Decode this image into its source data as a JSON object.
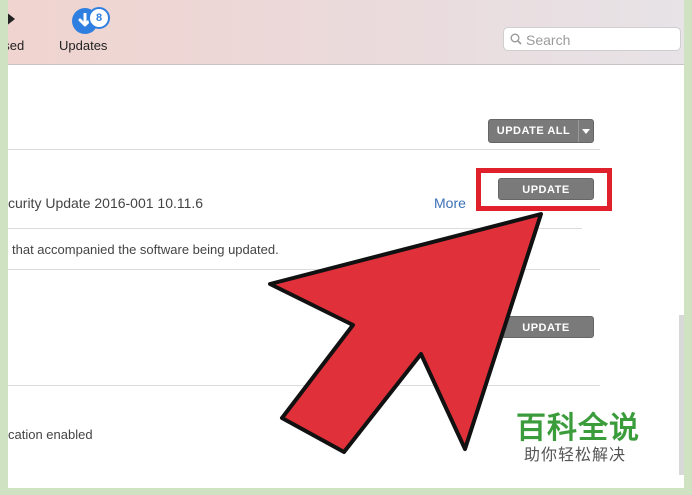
{
  "toolbar": {
    "purchased_label": "ased",
    "updates_label": "Updates",
    "updates_badge": "8"
  },
  "search": {
    "placeholder": "Search"
  },
  "main": {
    "update_all_label": "UPDATE ALL",
    "item1": {
      "title": "curity Update 2016-001 10.11.6",
      "more_label": "More",
      "button_label": "UPDATE",
      "note": "that accompanied the software being updated."
    },
    "item2": {
      "button_label": "UPDATE"
    },
    "item3": {
      "text": "cation enabled"
    }
  },
  "overlay": {
    "arrow_color": "#e0303a",
    "highlight_color": "#e0202a"
  },
  "watermark": {
    "title": "百科全说",
    "subtitle": "助你轻松解决"
  }
}
